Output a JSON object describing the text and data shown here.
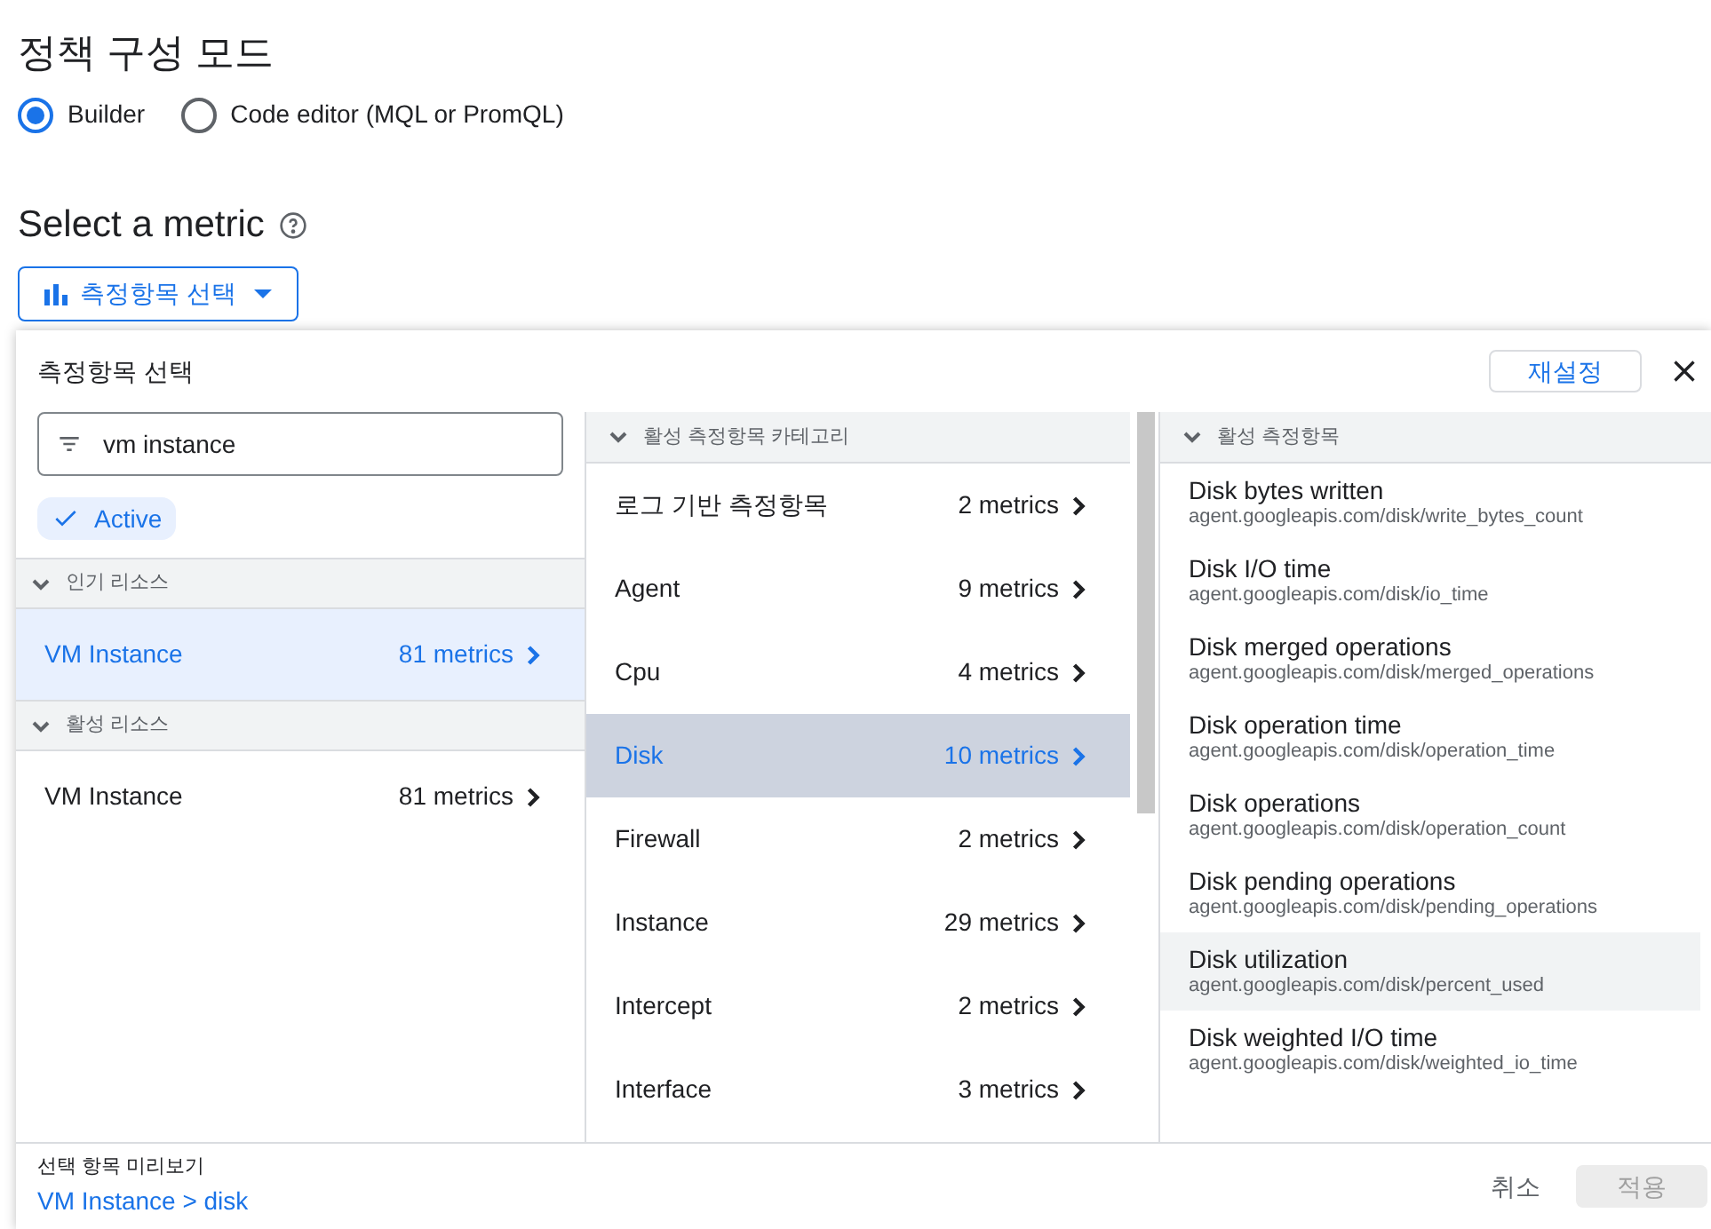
{
  "page_title": "정책 구성 모드",
  "modes": [
    {
      "label": "Builder",
      "selected": true
    },
    {
      "label": "Code editor (MQL or PromQL)",
      "selected": false
    }
  ],
  "section_title": "Select a metric",
  "metric_button": {
    "label": "측정항목 선택"
  },
  "panel": {
    "title": "측정항목 선택",
    "reset_button": "재설정",
    "search": {
      "value": "vm instance"
    },
    "filter_chip": {
      "label": "Active",
      "checked": true
    },
    "resource_groups": [
      {
        "title": "인기 리소스",
        "expanded": true,
        "items": [
          {
            "name": "VM Instance",
            "count": "81 metrics",
            "selected": true
          }
        ]
      },
      {
        "title": "활성 리소스",
        "expanded": true,
        "items": [
          {
            "name": "VM Instance",
            "count": "81 metrics",
            "selected": false
          }
        ]
      }
    ],
    "categories": {
      "title": "활성 측정항목 카테고리",
      "items": [
        {
          "name": "로그 기반 측정항목",
          "count": "2 metrics",
          "selected": false
        },
        {
          "name": "Agent",
          "count": "9 metrics",
          "selected": false
        },
        {
          "name": "Cpu",
          "count": "4 metrics",
          "selected": false
        },
        {
          "name": "Disk",
          "count": "10 metrics",
          "selected": true
        },
        {
          "name": "Firewall",
          "count": "2 metrics",
          "selected": false
        },
        {
          "name": "Instance",
          "count": "29 metrics",
          "selected": false
        },
        {
          "name": "Intercept",
          "count": "2 metrics",
          "selected": false
        },
        {
          "name": "Interface",
          "count": "3 metrics",
          "selected": false
        }
      ]
    },
    "metrics": {
      "title": "활성 측정항목",
      "items": [
        {
          "name": "Disk bytes written",
          "path": "agent.googleapis.com/disk/write_bytes_count",
          "highlighted": false
        },
        {
          "name": "Disk I/O time",
          "path": "agent.googleapis.com/disk/io_time",
          "highlighted": false
        },
        {
          "name": "Disk merged operations",
          "path": "agent.googleapis.com/disk/merged_operations",
          "highlighted": false
        },
        {
          "name": "Disk operation time",
          "path": "agent.googleapis.com/disk/operation_time",
          "highlighted": false
        },
        {
          "name": "Disk operations",
          "path": "agent.googleapis.com/disk/operation_count",
          "highlighted": false
        },
        {
          "name": "Disk pending operations",
          "path": "agent.googleapis.com/disk/pending_operations",
          "highlighted": false
        },
        {
          "name": "Disk utilization",
          "path": "agent.googleapis.com/disk/percent_used",
          "highlighted": true
        },
        {
          "name": "Disk weighted I/O time",
          "path": "agent.googleapis.com/disk/weighted_io_time",
          "highlighted": false
        }
      ]
    },
    "footer": {
      "preview_label": "선택 항목 미리보기",
      "preview_value": "VM Instance > disk",
      "cancel_button": "취소",
      "apply_button": {
        "label": "적용",
        "disabled": true
      }
    }
  }
}
